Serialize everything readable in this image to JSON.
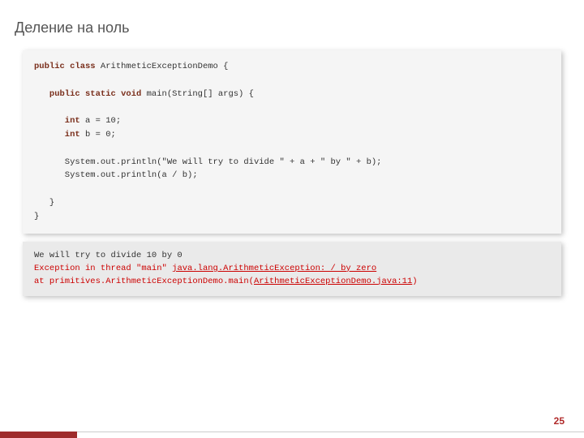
{
  "title": "Деление на ноль",
  "pageNumber": "25",
  "code": {
    "l1_kw1": "public class",
    "l1_cls": " ArithmeticExceptionDemo {",
    "l3_kw1": "   public static void",
    "l3_rest": " main(String[] args) {",
    "l5_kw": "      int",
    "l5_rest": " a = 10;",
    "l6_kw": "      int",
    "l6_rest": " b = 0;",
    "l8": "      System.out.println(\"We will try to divide \" + a + \" by \" + b);",
    "l9": "      System.out.println(a / b);",
    "l11": "   }",
    "l12": "}"
  },
  "output": {
    "line1": "We will try to divide 10 by 0",
    "line2a": "Exception in thread \"main\" ",
    "line2b": "java.lang.ArithmeticException: / by zero",
    "line3a": "at primitives.ArithmeticExceptionDemo.main(",
    "line3b": "ArithmeticExceptionDemo.java:11",
    "line3c": ")"
  }
}
